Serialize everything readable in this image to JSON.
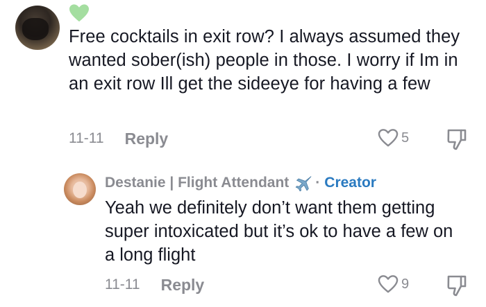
{
  "comment": {
    "text": "Free cocktails in exit row? I always assumed they wanted sober(ish) people in those. I worry if Im in an exit row Ill get the sideeye for having a few",
    "date": "11-11",
    "reply_label": "Reply",
    "likes": "5"
  },
  "reply_comment": {
    "author": "Destanie | Flight Attendant",
    "separator": "·",
    "badge": "Creator",
    "text": "Yeah we definitely don’t want them getting super intoxicated but it’s ok to have a few on a long flight",
    "date": "11-11",
    "reply_label": "Reply",
    "likes": "9"
  },
  "colors": {
    "text": "#161823",
    "muted": "#8a8b91",
    "creator": "#2a7ac0",
    "heart_badge": "#a4dea0"
  },
  "icons": [
    "green-heart-icon",
    "heart-outline-icon",
    "dislike-icon",
    "airplane-icon"
  ]
}
